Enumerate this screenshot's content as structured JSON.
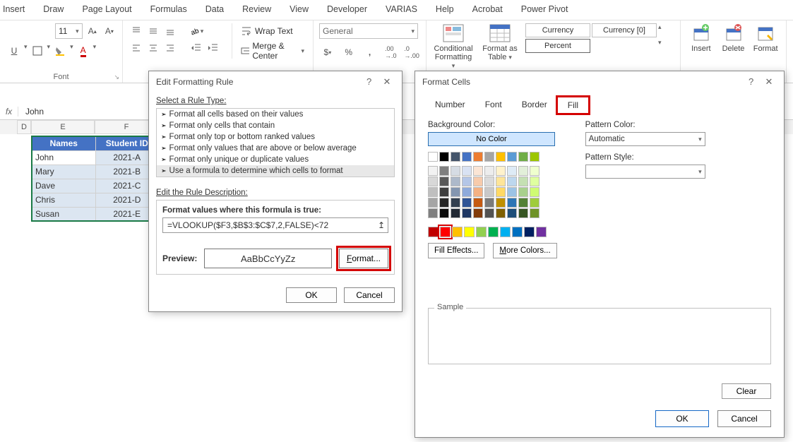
{
  "ribbon": {
    "tabs": [
      "Insert",
      "Draw",
      "Page Layout",
      "Formulas",
      "Data",
      "Review",
      "View",
      "Developer",
      "VARIAS",
      "Help",
      "Acrobat",
      "Power Pivot"
    ],
    "font_size": "11",
    "wrap_text": "Wrap Text",
    "merge_center": "Merge & Center",
    "number_format": "General",
    "cond_fmt": "Conditional Formatting",
    "fmt_table": "Format as Table",
    "styles": {
      "currency": "Currency",
      "currency0": "Currency [0]",
      "percent": "Percent"
    },
    "insert": "Insert",
    "delete": "Delete",
    "format": "Format",
    "group_font": "Font"
  },
  "formula_bar": {
    "value": "John"
  },
  "sheet": {
    "cols": [
      "D",
      "E",
      "F"
    ],
    "headers": [
      "Names",
      "Student ID"
    ],
    "rows": [
      {
        "name": "John",
        "id": "2021-A"
      },
      {
        "name": "Mary",
        "id": "2021-B"
      },
      {
        "name": "Dave",
        "id": "2021-C"
      },
      {
        "name": "Chris",
        "id": "2021-D"
      },
      {
        "name": "Susan",
        "id": "2021-E"
      }
    ]
  },
  "edit_rule": {
    "title": "Edit Formatting Rule",
    "select_lbl": "Select a Rule Type:",
    "types": [
      "Format all cells based on their values",
      "Format only cells that contain",
      "Format only top or bottom ranked values",
      "Format only values that are above or below average",
      "Format only unique or duplicate values",
      "Use a formula to determine which cells to format"
    ],
    "edit_lbl": "Edit the Rule Description:",
    "formula_lbl": "Format values where this formula is true:",
    "formula": "=VLOOKUP($F3,$B$3:$C$7,2,FALSE)<72",
    "preview_lbl": "Preview:",
    "preview_sample": "AaBbCcYyZz",
    "format_btn": "Format...",
    "ok": "OK",
    "cancel": "Cancel"
  },
  "format_cells": {
    "title": "Format Cells",
    "tabs": [
      "Number",
      "Font",
      "Border",
      "Fill"
    ],
    "bg_lbl": "Background Color:",
    "no_color": "No Color",
    "fill_effects": "Fill Effects...",
    "more_colors": "More Colors...",
    "pat_color_lbl": "Pattern Color:",
    "pat_auto": "Automatic",
    "pat_style_lbl": "Pattern Style:",
    "sample_lbl": "Sample",
    "clear": "Clear",
    "ok": "OK",
    "cancel": "Cancel",
    "theme_row1": [
      "#ffffff",
      "#000000",
      "#44546a",
      "#4472c4",
      "#ed7d31",
      "#a5a5a5",
      "#ffc000",
      "#5b9bd5",
      "#70ad47",
      "#9cc600"
    ],
    "theme_shades": [
      [
        "#f2f2f2",
        "#7f7f7f",
        "#d6dce4",
        "#d9e2f3",
        "#fbe5d5",
        "#ededed",
        "#fff2cc",
        "#deebf6",
        "#e2efd9",
        "#efffce"
      ],
      [
        "#d8d8d8",
        "#595959",
        "#adb9ca",
        "#b4c6e7",
        "#f7cbac",
        "#dbdbdb",
        "#fee599",
        "#bdd7ee",
        "#c5e0b3",
        "#dfffa0"
      ],
      [
        "#bfbfbf",
        "#3f3f3f",
        "#8496b0",
        "#8eaadb",
        "#f4b183",
        "#c9c9c9",
        "#ffd965",
        "#9cc3e5",
        "#a8d08d",
        "#cffb73"
      ],
      [
        "#a5a5a5",
        "#262626",
        "#323f4f",
        "#2f5496",
        "#c55a11",
        "#7b7b7b",
        "#bf9000",
        "#2e75b5",
        "#538135",
        "#9fcc3c"
      ],
      [
        "#7f7f7f",
        "#0c0c0c",
        "#222a35",
        "#1f3864",
        "#833c0b",
        "#525252",
        "#7f6000",
        "#1e4e79",
        "#375623",
        "#6f9228"
      ]
    ],
    "standard": [
      "#c00000",
      "#ff0000",
      "#ffc000",
      "#ffff00",
      "#92d050",
      "#00b050",
      "#00b0f0",
      "#0070c0",
      "#002060",
      "#7030a0"
    ]
  }
}
